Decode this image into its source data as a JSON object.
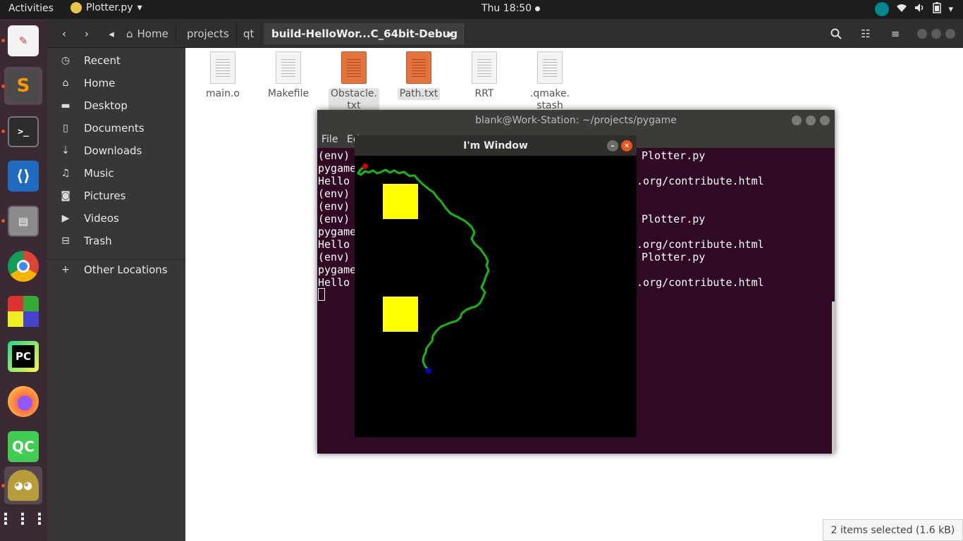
{
  "topbar": {
    "activities": "Activities",
    "app_name": "Plotter.py",
    "clock": "Thu 18:50",
    "tray_icons": [
      "arduino-icon",
      "wifi-icon",
      "volume-icon",
      "battery-icon",
      "chevron-down-icon"
    ]
  },
  "dock": {
    "items": [
      {
        "name": "text-editor",
        "color": "#f3f3f3"
      },
      {
        "name": "sublime-text",
        "color": "#4a4a4a"
      },
      {
        "name": "terminal",
        "color": "#2c2c2c"
      },
      {
        "name": "vscode",
        "color": "#1e6bbf"
      },
      {
        "name": "file-cabinet",
        "color": "#8b8b8b"
      },
      {
        "name": "chrome",
        "color": "#db4437"
      },
      {
        "name": "minecraft",
        "color": "#5c8d2e"
      },
      {
        "name": "pycharm",
        "color": "#21d789"
      },
      {
        "name": "firefox",
        "color": "#ff7139"
      },
      {
        "name": "qt-creator",
        "color": "#41cd52"
      },
      {
        "name": "pygame",
        "color": "#f0c040"
      },
      {
        "name": "app-grid",
        "color": "#3b2a34"
      }
    ],
    "pycharm_label": "PC",
    "qt_label": "QC"
  },
  "fm": {
    "breadcrumbs": [
      "Home",
      "projects",
      "qt",
      "build-HelloWor...C_64bit-Debug"
    ],
    "sidebar": [
      {
        "label": "Recent",
        "icon": "clock-icon"
      },
      {
        "label": "Home",
        "icon": "home-icon"
      },
      {
        "label": "Desktop",
        "icon": "folder-icon"
      },
      {
        "label": "Documents",
        "icon": "document-icon"
      },
      {
        "label": "Downloads",
        "icon": "download-icon"
      },
      {
        "label": "Music",
        "icon": "music-icon"
      },
      {
        "label": "Pictures",
        "icon": "camera-icon"
      },
      {
        "label": "Videos",
        "icon": "video-icon"
      },
      {
        "label": "Trash",
        "icon": "trash-icon"
      },
      {
        "label": "Other Locations",
        "icon": "plus-icon"
      }
    ],
    "files": [
      {
        "name": "main.o",
        "type": "plain"
      },
      {
        "name": "Makefile",
        "type": "plain"
      },
      {
        "name": "Obstacle.\ntxt",
        "type": "orange"
      },
      {
        "name": "Path.txt",
        "type": "orange"
      },
      {
        "name": "RRT",
        "type": "plain"
      },
      {
        "name": ".qmake.\nstash",
        "type": "plain"
      }
    ],
    "status": "2 items selected  (1.6 kB)"
  },
  "terminal": {
    "title": "blank@Work-Station: ~/projects/pygame",
    "menu": [
      "File",
      "Ed"
    ],
    "left_lines": [
      "(env)",
      "pygame",
      "Hello",
      "(env)",
      "(env)",
      "(env)",
      "pygame",
      "Hello",
      "(env)",
      "pygame",
      "Hello"
    ],
    "right_lines": [
      "Plotter.py",
      "",
      "e.org/contribute.html",
      "",
      "",
      "Plotter.py",
      "",
      "e.org/contribute.html",
      "Plotter.py",
      "",
      "e.org/contribute.html"
    ]
  },
  "pygame": {
    "title": "I'm Window",
    "obstacle_color": "#ffff00",
    "path_color": "#14b814",
    "start_color": "#cc0000",
    "goal_color": "#0000cc"
  }
}
